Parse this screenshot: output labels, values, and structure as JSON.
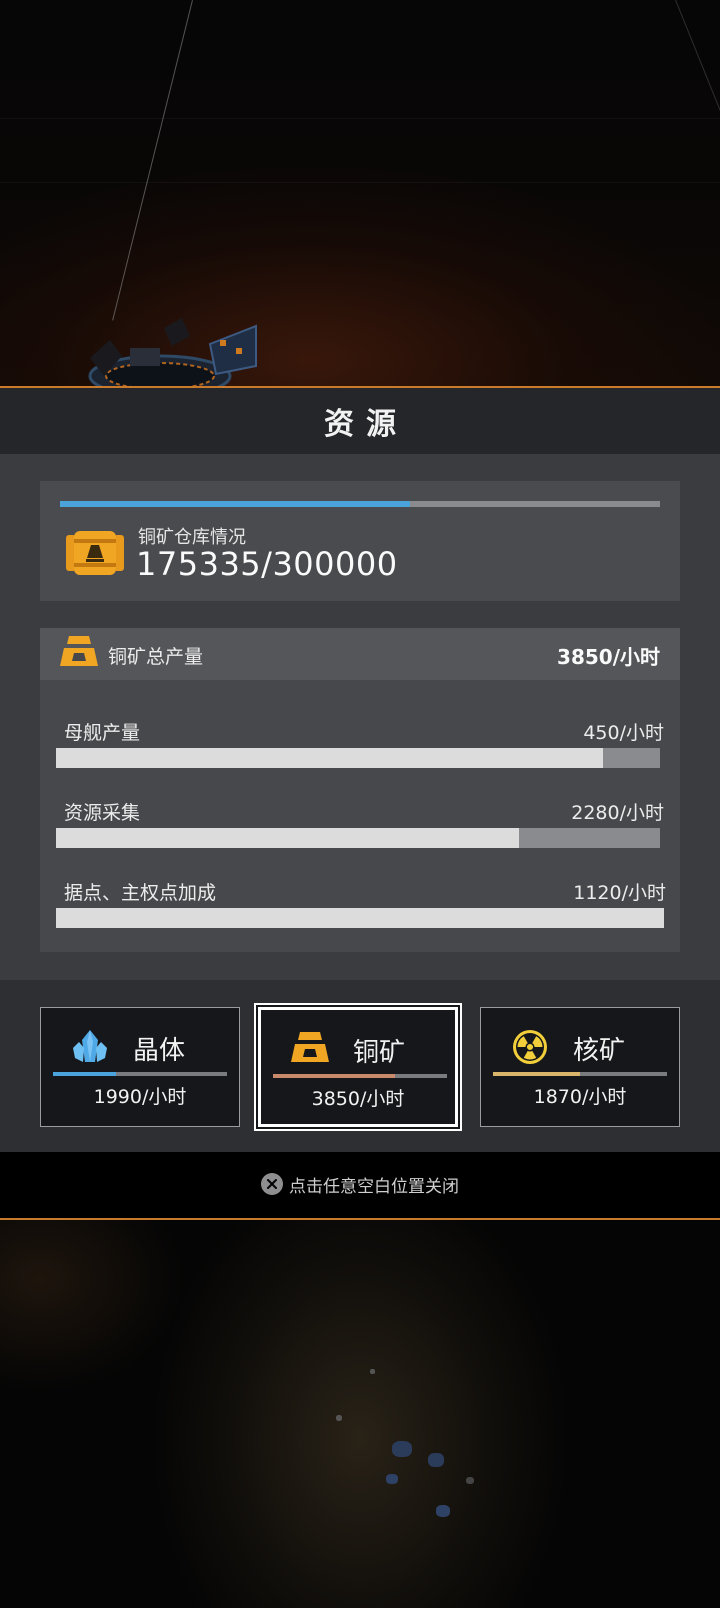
{
  "panel": {
    "title": "资源",
    "storage": {
      "label": "铜矿仓库情况",
      "value": "175335/300000",
      "fill_fraction": 0.584,
      "bar_color": "#4ba3db"
    },
    "production": {
      "label": "铜矿总产量",
      "total": "3850/小时",
      "rows": [
        {
          "name": "母舰产量",
          "value": "450/小时",
          "fill_fraction": 0.906
        },
        {
          "name": "资源采集",
          "value": "2280/小时",
          "fill_fraction": 0.767
        },
        {
          "name": "据点、主权点加成",
          "value": "1120/小时",
          "fill_fraction": 1.0
        }
      ]
    },
    "resources": [
      {
        "name": "晶体",
        "rate": "1990/小时",
        "icon": "crystal-icon",
        "bar_color": "#4ba3db",
        "fill_fraction": 0.36,
        "selected": false
      },
      {
        "name": "铜矿",
        "rate": "3850/小时",
        "icon": "copper-ingot-icon",
        "bar_color": "#c98a6c",
        "fill_fraction": 0.7,
        "selected": true
      },
      {
        "name": "核矿",
        "rate": "1870/小时",
        "icon": "radiation-icon",
        "bar_color": "#d8b56a",
        "fill_fraction": 0.5,
        "selected": false
      }
    ],
    "close_hint": "点击任意空白位置关闭"
  },
  "colors": {
    "accent_line": "#c97a2a",
    "copper": "#e79a1c"
  }
}
